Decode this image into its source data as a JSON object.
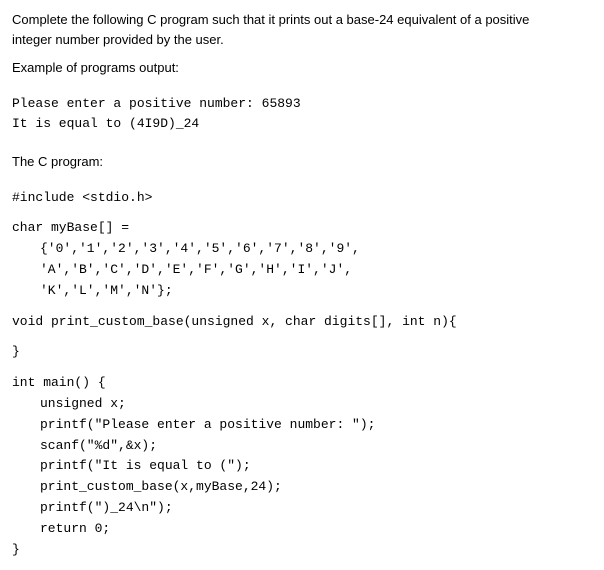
{
  "description": {
    "line1": "Complete the following C program such that it prints out a base-24 equivalent of a positive",
    "line2": "integer number provided by the user."
  },
  "example": {
    "label": "Example of programs output:",
    "line1": "Please enter a positive number: 65893",
    "line2": "It is equal to (4I9D)_24"
  },
  "program_label": "The C program:",
  "code": {
    "include": "#include <stdio.h>",
    "mybase_decl": "char myBase[] =",
    "mybase_row1": "{'0','1','2','3','4','5','6','7','8','9',",
    "mybase_row2": "'A','B','C','D','E','F','G','H','I','J',",
    "mybase_row3": "'K','L','M','N'};",
    "void_decl": "void print_custom_base(unsigned x, char digits[], int n){",
    "void_close": "}",
    "main_decl": "int main() {",
    "main_unsigned": "unsigned x;",
    "main_printf1": "printf(\"Please enter a positive number: \");",
    "main_scanf": "scanf(\"%d\",&x);",
    "main_printf2": "printf(\"It is equal to (\");",
    "main_print_custom": "print_custom_base(x,myBase,24);",
    "main_printf3": "printf(\")_24\\n\");",
    "main_return": "return 0;",
    "main_close": "}"
  }
}
